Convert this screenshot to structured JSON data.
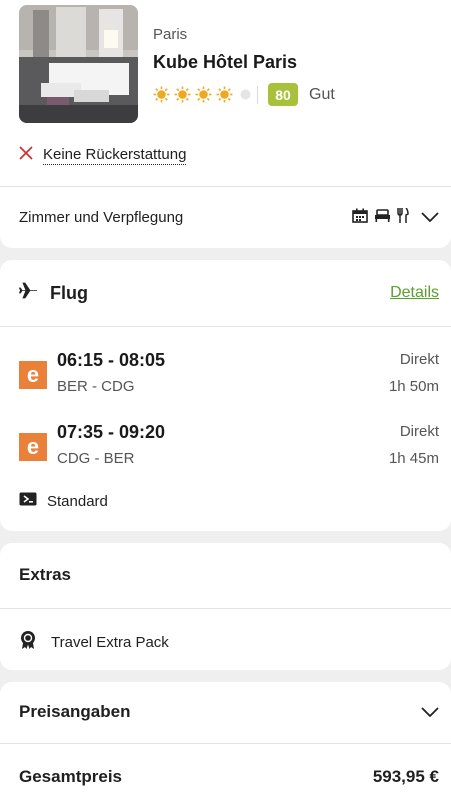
{
  "hotel": {
    "city": "Paris",
    "name": "Kube Hôtel Paris",
    "sun_rating": 4,
    "sun_max": 5,
    "score": "80",
    "score_label": "Gut",
    "cancellation": "Keine Rückerstattung"
  },
  "board": {
    "label": "Zimmer und Verpflegung",
    "icons": [
      "calendar-icon",
      "bed-icon",
      "cutlery-icon"
    ]
  },
  "flight": {
    "title": "Flug",
    "details_link": "Details",
    "legs": [
      {
        "logo": "e",
        "time": "06:15 - 08:05",
        "route": "BER - CDG",
        "type": "Direkt",
        "duration": "1h 50m"
      },
      {
        "logo": "e",
        "time": "07:35 - 09:20",
        "route": "CDG - BER",
        "type": "Direkt",
        "duration": "1h 45m"
      }
    ],
    "fare": "Standard"
  },
  "extras": {
    "title": "Extras",
    "item": "Travel Extra Pack"
  },
  "price": {
    "title": "Preisangaben",
    "total_label": "Gesamtpreis",
    "total_value": "593,95 €"
  },
  "colors": {
    "accent_green": "#5aa02c",
    "score_badge": "#a8c13a",
    "airline_orange": "#e9813a",
    "sun_active": "#f0a81e",
    "cancel_red": "#d22b2b"
  }
}
